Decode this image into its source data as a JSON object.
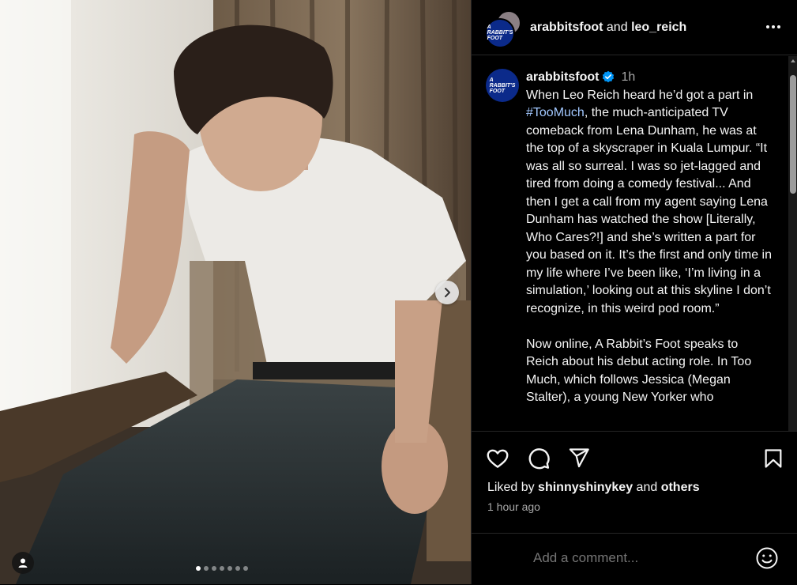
{
  "header": {
    "user1": "arabbitsfoot",
    "connector": "and",
    "user2": "leo_reich",
    "more_icon": "more-horizontal-icon"
  },
  "brand": {
    "logo_line1": "A",
    "logo_line2": "RABBIT'S",
    "logo_line3": "FOOT",
    "accent": "#0b2a8a",
    "verified_color": "#0095f6"
  },
  "caption": {
    "username": "arabbitsfoot",
    "time": "1h",
    "before_hashtag": "When Leo Reich heard he’d got a part in ",
    "hashtag": "#TooMuch",
    "after_hashtag": ", the much-anticipated TV comeback from Lena Dunham, he was at the top of a skyscraper in Kuala Lumpur. “It was all so surreal. I was so jet-lagged and tired from doing a comedy festival... And then I get a call from my agent saying Lena Dunham has watched the show [Literally, Who Cares?!] and she’s written a part for you based on it. It’s the first and only time in my life where I’ve been like, ‘I’m living in a simulation,’ looking out at this skyline I don’t recognize, in this weird pod room.”",
    "paragraph2": "Now online, A Rabbit’s Foot speaks to Reich about his debut acting role. In Too Much, which follows Jessica (Megan Stalter), a young New Yorker who"
  },
  "actions": {
    "like_icon": "heart-icon",
    "comment_icon": "comment-icon",
    "share_icon": "send-icon",
    "save_icon": "bookmark-icon"
  },
  "likes": {
    "prefix": "Liked by",
    "user": "shinnyshinykey",
    "connector": "and",
    "others": "others"
  },
  "timestamp": "1 hour ago",
  "comment": {
    "placeholder": "Add a comment...",
    "emoji_icon": "smiley-icon"
  },
  "carousel": {
    "total": 7,
    "current": 1,
    "next_icon": "chevron-right-icon",
    "tag_icon": "user-tag-icon"
  }
}
